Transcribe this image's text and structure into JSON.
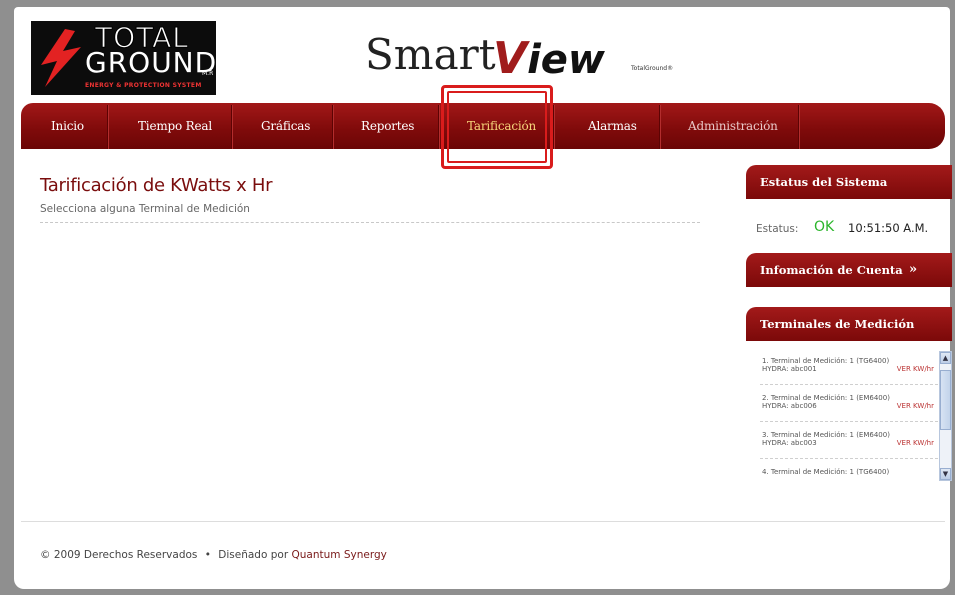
{
  "header": {
    "logo": {
      "line1": "TOTAL",
      "line2": "GROUND",
      "mark": "M.R",
      "tagline": "ENERGY & PROTECTION SYSTEM"
    },
    "brand": {
      "smart": "Smart",
      "view": "View",
      "sub": "TotalGround®"
    }
  },
  "nav": {
    "items": [
      {
        "label": "Inicio"
      },
      {
        "label": "Tiempo Real"
      },
      {
        "label": "Gráficas"
      },
      {
        "label": "Reportes"
      },
      {
        "label": "Tarificación",
        "active": true
      },
      {
        "label": "Alarmas"
      },
      {
        "label": "Administración"
      }
    ]
  },
  "main": {
    "title": "Tarificación de KWatts x Hr",
    "subtitle": "Selecciona alguna Terminal de Medición"
  },
  "sidebar": {
    "status": {
      "heading": "Estatus del Sistema",
      "label": "Estatus:",
      "value": "OK",
      "time": "10:51:50 A.M."
    },
    "account": {
      "heading": "Infomación de Cuenta"
    },
    "terminals": {
      "heading": "Terminales de Medición",
      "items": [
        {
          "line1": "1. Terminal de Medición: 1 (TG6400)",
          "line2": "HYDRA: abc001",
          "link": "VER KW/hr"
        },
        {
          "line1": "2. Terminal de Medición: 1 (EM6400)",
          "line2": "HYDRA: abc006",
          "link": "VER KW/hr"
        },
        {
          "line1": "3. Terminal de Medición: 1 (EM6400)",
          "line2": "HYDRA: abc003",
          "link": "VER KW/hr"
        },
        {
          "line1": "4. Terminal de Medición: 1 (TG6400)",
          "line2": "",
          "link": ""
        }
      ]
    }
  },
  "footer": {
    "copyright": "© 2009 Derechos Reservados",
    "bullet": "•",
    "designed": "Diseñado por",
    "company": "Quantum Synergy"
  },
  "colors": {
    "nav": "#7e0a0a",
    "active": "#f6d47a",
    "ok": "#2bb52b",
    "highlight": "#d91c1c"
  }
}
